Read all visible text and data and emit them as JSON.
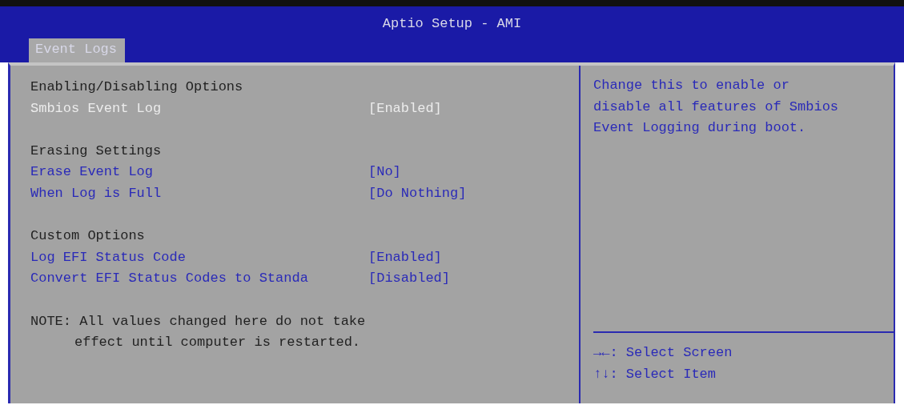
{
  "window": {
    "title": "Aptio Setup - AMI"
  },
  "tabs": [
    {
      "label": "Event Logs",
      "selected": true
    }
  ],
  "sections": [
    {
      "title": "Enabling/Disabling Options",
      "options": [
        {
          "label": "Smbios Event Log",
          "value": "[Enabled]",
          "selected": true
        }
      ]
    },
    {
      "title": "Erasing Settings",
      "options": [
        {
          "label": "Erase Event Log",
          "value": "[No]",
          "selected": false
        },
        {
          "label": "When Log is Full",
          "value": "[Do Nothing]",
          "selected": false
        }
      ]
    },
    {
      "title": "Custom Options",
      "options": [
        {
          "label": "Log EFI Status Code",
          "value": "[Enabled]",
          "selected": false
        },
        {
          "label": "Convert EFI Status Codes to Standa",
          "value": "[Disabled]",
          "selected": false
        }
      ]
    }
  ],
  "note": [
    "NOTE: All values changed here do not take",
    "effect until computer is restarted."
  ],
  "help": {
    "text": "Change this to enable or disable all features of Smbios Event Logging during boot.",
    "keys": [
      {
        "key": "→←",
        "action": ": Select Screen"
      },
      {
        "key": "↑↓",
        "action": ": Select Item"
      }
    ]
  }
}
